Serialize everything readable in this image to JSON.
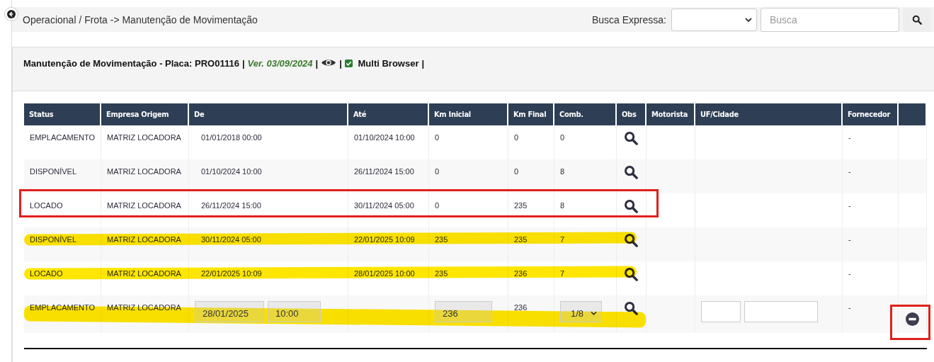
{
  "breadcrumb": "Operacional / Frota -> Manutenção de Movimentação",
  "quick_search": {
    "label": "Busca Expressa:",
    "placeholder": "Busca"
  },
  "panel_header": [
    {
      "kind": "title",
      "text": "Manutenção de Movimentação - Placa: PRO01116"
    },
    {
      "kind": "separator",
      "text": "|"
    },
    {
      "kind": "version",
      "text": "Ver. 03/09/2024"
    },
    {
      "kind": "separator",
      "text": "|"
    },
    {
      "kind": "eye"
    },
    {
      "kind": "separator",
      "text": "|"
    },
    {
      "kind": "checkbox",
      "checked": true,
      "text": "Multi Browser"
    },
    {
      "kind": "separator",
      "text": "|"
    }
  ],
  "table": {
    "columns": [
      "Status",
      "Empresa Origem",
      "De",
      "Até",
      "Km Inicial",
      "Km Final",
      "Comb.",
      "Obs",
      "Motorista",
      "UF/Cidade",
      "Fornecedor"
    ],
    "rows": [
      {
        "kind": "view",
        "cells": [
          "EMPLACAMENTO",
          "MATRIZ LOCADORA",
          "01/01/2018 00:00",
          "01/10/2024 10:00",
          "0",
          "0",
          "0"
        ],
        "fornecedor": "-",
        "highlighted": false,
        "boxed": false
      },
      {
        "kind": "view",
        "cells": [
          "DISPONÍVEL",
          "MATRIZ LOCADORA",
          "01/10/2024 10:00",
          "26/11/2024 15:00",
          "0",
          "0",
          "8"
        ],
        "fornecedor": "-",
        "highlighted": false,
        "boxed": false
      },
      {
        "kind": "view",
        "cells": [
          "LOCADO",
          "MATRIZ LOCADORA",
          "26/11/2024 15:00",
          "30/11/2024 05:00",
          "0",
          "235",
          "8"
        ],
        "fornecedor": "-",
        "highlighted": false,
        "boxed": true
      },
      {
        "kind": "view",
        "cells": [
          "DISPONÍVEL",
          "MATRIZ LOCADORA",
          "30/11/2024 05:00",
          "22/01/2025 10:09",
          "235",
          "235",
          "7"
        ],
        "fornecedor": "-",
        "highlighted": true,
        "boxed": false
      },
      {
        "kind": "view",
        "cells": [
          "LOCADO",
          "MATRIZ LOCADORA",
          "22/01/2025 10:09",
          "28/01/2025 10:00",
          "235",
          "236",
          "7"
        ],
        "fornecedor": "-",
        "highlighted": true,
        "boxed": false
      },
      {
        "kind": "edit",
        "status": "EMPLACAMENTO",
        "empresa": "MATRIZ LOCADORA",
        "de_date": "28/01/2025",
        "de_time": "10:00",
        "km_inicial": "236",
        "km_final": "236",
        "comb": "1/8",
        "fornecedor": "-",
        "highlighted": true,
        "remove_boxed": true
      }
    ]
  }
}
